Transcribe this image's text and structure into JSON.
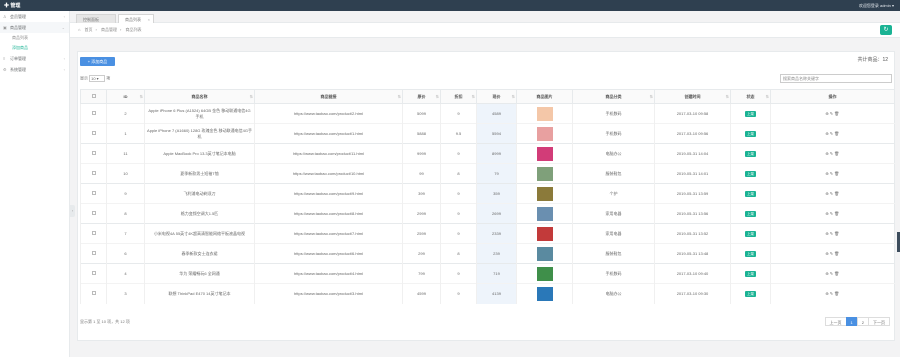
{
  "topbar": {
    "brand": "✚ 管理",
    "user": "欢迎您登录 admin ▾"
  },
  "sidebar": {
    "items": [
      {
        "label": "会员管理",
        "open": false
      },
      {
        "label": "商品管理",
        "open": true
      },
      {
        "label": "订单管理",
        "open": false
      },
      {
        "label": "系统管理",
        "open": false
      }
    ],
    "subitems": [
      {
        "label": "商品列表",
        "active": false
      },
      {
        "label": "添加商品",
        "active": true
      }
    ]
  },
  "tabs": [
    {
      "label": "控制面板"
    },
    {
      "label": "商品列表"
    }
  ],
  "breadcrumb": [
    "首页",
    "商品管理",
    "商品列表"
  ],
  "toolbar": {
    "add_label": "+ 添加商品",
    "total_label": "共计商品：12"
  },
  "table_controls": {
    "show_prefix": "显示",
    "page_size": "10 ▾",
    "show_suffix": "项",
    "search_placeholder": "搜索商品名称关键字"
  },
  "columns": [
    "",
    "ID",
    "商品名称",
    "商品链接",
    "原价",
    "折扣",
    "现价",
    "商品图片",
    "商品分类",
    "创建时间",
    "状态",
    "操作"
  ],
  "rows": [
    {
      "id": "2",
      "name": "Apple iPhone 6 Plus (A1524) 64GB 金色 移动联通电信4G手机",
      "url": "https://www.taobao.com/product/2.html",
      "orig": "5099",
      "disc": "9",
      "price": "4589",
      "cat": "手机数码",
      "time": "2017-03-10 09:58",
      "status": "上架",
      "img": "#f4c7a8"
    },
    {
      "id": "1",
      "name": "Apple iPhone 7 (A1660) 128G 玫瑰金色 移动联通电信4G手机",
      "url": "https://www.taobao.com/product/1.html",
      "orig": "5888",
      "disc": "9.5",
      "price": "5594",
      "cat": "手机数码",
      "time": "2017-03-10 09:56",
      "status": "上架",
      "img": "#e8a0a0"
    },
    {
      "id": "11",
      "name": "Apple MacBook Pro 13.3英寸笔记本电脑",
      "url": "https://www.taobao.com/product/11.html",
      "orig": "9999",
      "disc": "9",
      "price": "8999",
      "cat": "电脑办公",
      "time": "2019-05-31 14:04",
      "status": "上架",
      "img": "#d23c78"
    },
    {
      "id": "10",
      "name": "夏季新款男士短袖T恤",
      "url": "https://www.taobao.com/product/10.html",
      "orig": "99",
      "disc": "8",
      "price": "79",
      "cat": "服装鞋包",
      "time": "2019-05-31 14:01",
      "status": "上架",
      "img": "#7fa07a"
    },
    {
      "id": "9",
      "name": "飞利浦电动剃须刀",
      "url": "https://www.taobao.com/product/9.html",
      "orig": "399",
      "disc": "9",
      "price": "359",
      "cat": "个护",
      "time": "2019-05-31 13:59",
      "status": "上架",
      "img": "#8b7a3a"
    },
    {
      "id": "8",
      "name": "格力变频空调大1.5匹",
      "url": "https://www.taobao.com/product/8.html",
      "orig": "2999",
      "disc": "9",
      "price": "2699",
      "cat": "家用电器",
      "time": "2019-05-31 13:56",
      "status": "上架",
      "img": "#6a8fb0"
    },
    {
      "id": "7",
      "name": "小米电视4A 55英寸4K超高清智能网络平板液晶电视",
      "url": "https://www.taobao.com/product/7.html",
      "orig": "2599",
      "disc": "9",
      "price": "2339",
      "cat": "家用电器",
      "time": "2019-05-31 13:52",
      "status": "上架",
      "img": "#c23a3a"
    },
    {
      "id": "6",
      "name": "春季新款女士连衣裙",
      "url": "https://www.taobao.com/product/6.html",
      "orig": "299",
      "disc": "8",
      "price": "239",
      "cat": "服装鞋包",
      "time": "2019-05-31 13:48",
      "status": "上架",
      "img": "#5a8aa0"
    },
    {
      "id": "4",
      "name": "华为 荣耀畅玩6 全网通",
      "url": "https://www.taobao.com/product/4.html",
      "orig": "799",
      "disc": "9",
      "price": "719",
      "cat": "手机数码",
      "time": "2017-03-10 09:40",
      "status": "上架",
      "img": "#3f8f4a"
    },
    {
      "id": "3",
      "name": "联想 ThinkPad E470 14英寸笔记本",
      "url": "https://www.taobao.com/product/3.html",
      "orig": "4599",
      "disc": "9",
      "price": "4139",
      "cat": "电脑办公",
      "time": "2017-03-10 09:30",
      "status": "上架",
      "img": "#2a78b8"
    }
  ],
  "footer": {
    "info": "显示第 1 至 10 项，共 12 项",
    "pager": [
      "上一页",
      "1",
      "2",
      "下一页"
    ]
  },
  "colors": {
    "accent": "#1ab394",
    "primary": "#4a90e2",
    "topbar": "#2f4050"
  }
}
